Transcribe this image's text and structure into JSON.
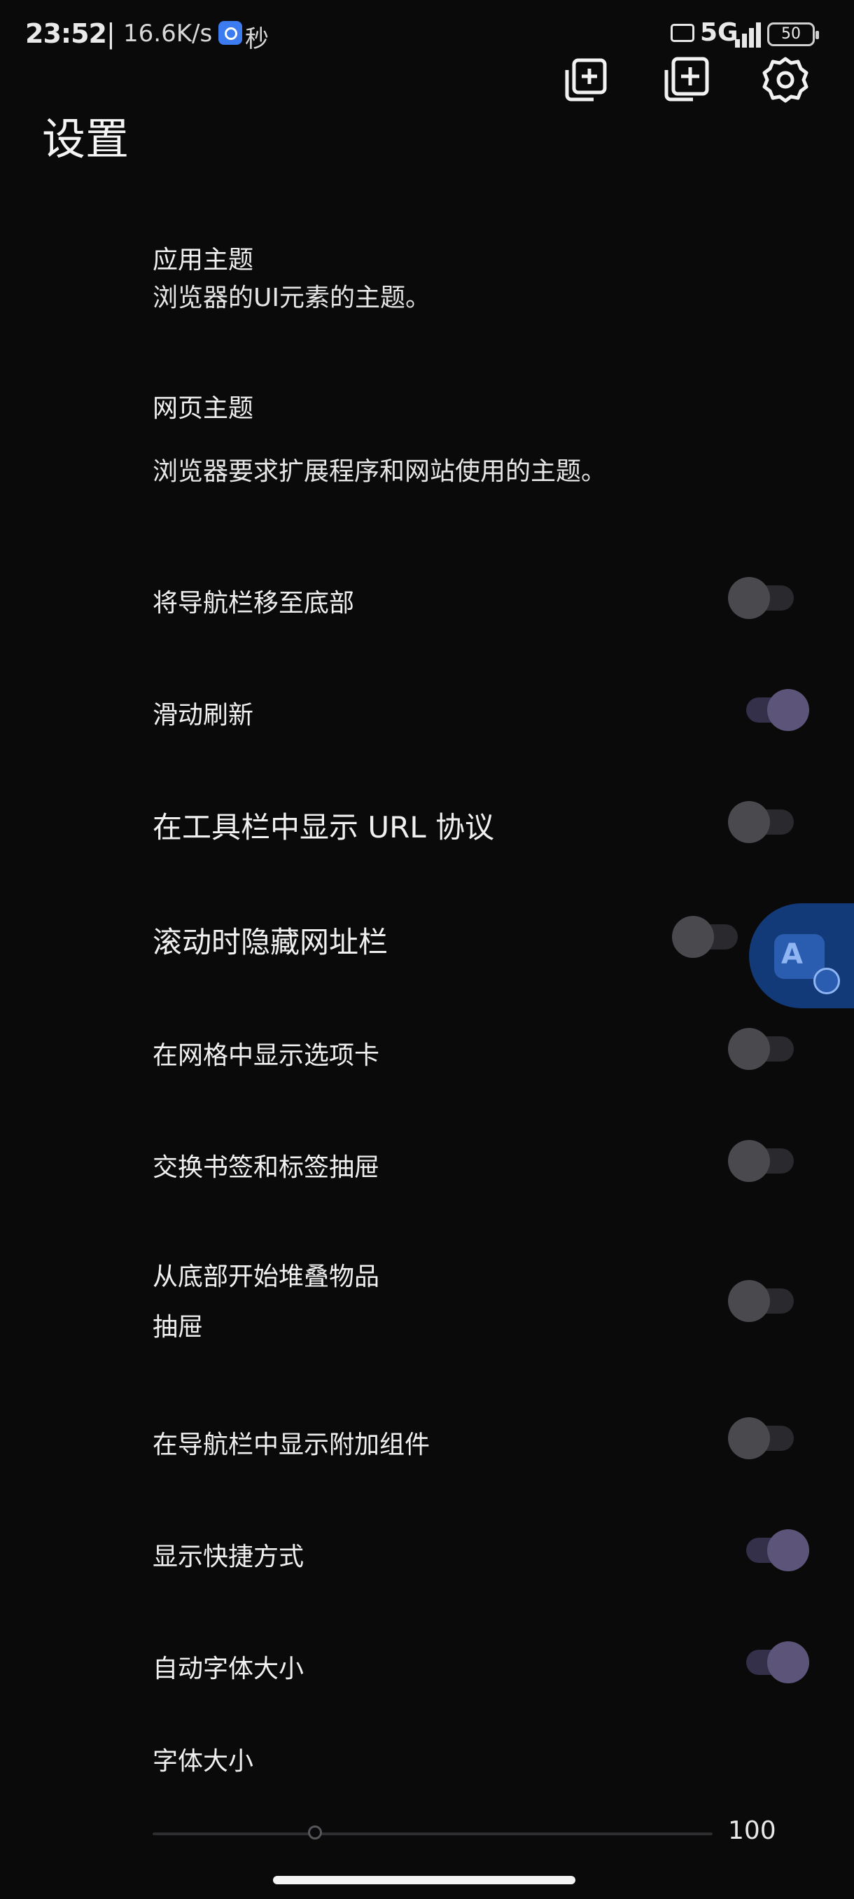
{
  "status_bar": {
    "time": "23:52",
    "separator": "|",
    "speed": "16.6K/s",
    "app_suffix": "秒",
    "network": "5G",
    "battery": "50"
  },
  "toolbar": {
    "icons": [
      "copy-tab-icon",
      "new-tab-icon",
      "settings-gear-icon"
    ]
  },
  "page": {
    "title": "设置"
  },
  "settings": [
    {
      "title": "应用主题",
      "description": "浏览器的UI元素的主题。"
    },
    {
      "title": "网页主题",
      "description": "浏览器要求扩展程序和网站使用的主题。"
    },
    {
      "title": "将导航栏移至底部",
      "enabled": false
    },
    {
      "title": "滑动刷新",
      "enabled": true
    },
    {
      "title": "在工具栏中显示 URL 协议",
      "enabled": false
    },
    {
      "title": "滚动时隐藏网址栏",
      "enabled": false
    },
    {
      "title": "在网格中显示选项卡",
      "enabled": false
    },
    {
      "title": "交换书签和标签抽屉",
      "enabled": false
    },
    {
      "title_line1": "从底部开始堆叠物品",
      "title_line2": "抽屉",
      "enabled": false
    },
    {
      "title": "在导航栏中显示附加组件",
      "enabled": false
    },
    {
      "title": "显示快捷方式",
      "enabled": true
    },
    {
      "title": "自动字体大小",
      "enabled": true
    },
    {
      "title": "字体大小"
    }
  ],
  "font_size_slider": {
    "value_label": "100",
    "level": 0.29
  },
  "colors": {
    "background": "#0a0a0b",
    "switch_on": "#5c5579",
    "switch_off": "#4a4a4e",
    "float_button": "#123a78"
  }
}
